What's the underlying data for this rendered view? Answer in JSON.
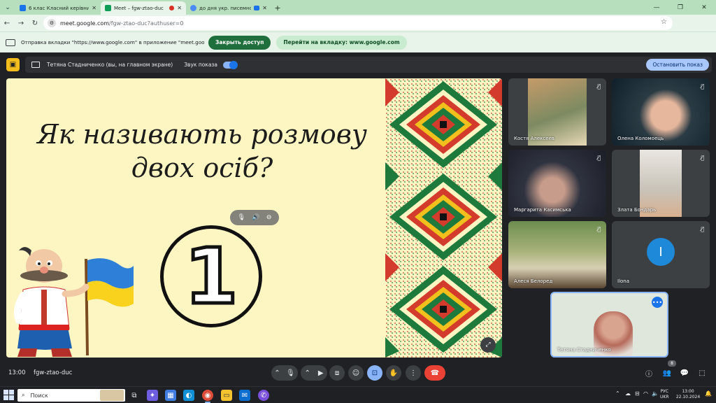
{
  "browser": {
    "tabs": [
      {
        "title": "6 клас Класний керівник Кузь",
        "favicon_color": "#1a73e8",
        "active": false
      },
      {
        "title": "Meet – fgw-ztao-duc",
        "favicon_color": "#0f9d58",
        "active": true
      },
      {
        "title": "до дня укр. писемності та",
        "favicon_color": "#4c8bf5",
        "active": false
      }
    ],
    "url_host": "meet.google.com",
    "url_path": "/fgw-ztao-duc?authuser=0",
    "profile_initial": "T",
    "share_message": "Отправка вкладки \"https://www.google.com\" в приложение \"meet.google.com\"...",
    "stop_access_label": "Закрыть доступ",
    "go_to_tab_label": "Перейти на вкладку: www.google.com"
  },
  "meet": {
    "presenter_text": "Тетяна Стадниченко (вы, на главном экране)",
    "audio_label": "Звук показа",
    "stop_presenting_label": "Остановить показ",
    "slide": {
      "title_line1": "Як називають розмову",
      "title_line2": "двох осіб?",
      "number": "1"
    },
    "participants": [
      {
        "name": "Костя Алексеев",
        "muted": true
      },
      {
        "name": "Олена Коломоець",
        "muted": true
      },
      {
        "name": "Маргарита Касимська",
        "muted": true
      },
      {
        "name": "Злата Бондарь",
        "muted": true
      },
      {
        "name": "Алеся Белоред",
        "muted": true
      },
      {
        "name": "Ilona",
        "initial": "I",
        "muted": true
      }
    ],
    "self_name": "Тетяна Стадниченко",
    "time": "13:00",
    "meeting_code": "fgw-ztao-duc",
    "people_count": "8"
  },
  "taskbar": {
    "search_placeholder": "Поиск",
    "lang_top": "РУС",
    "lang_bottom": "UKR",
    "clock_time": "13:00",
    "clock_date": "22.10.2024"
  },
  "colors": {
    "chrome_green": "#b8dfbd",
    "meet_bg": "#202124",
    "accent_blue": "#8ab4f8",
    "hangup_red": "#ea4335",
    "present_yellow": "#f3bd1e"
  }
}
